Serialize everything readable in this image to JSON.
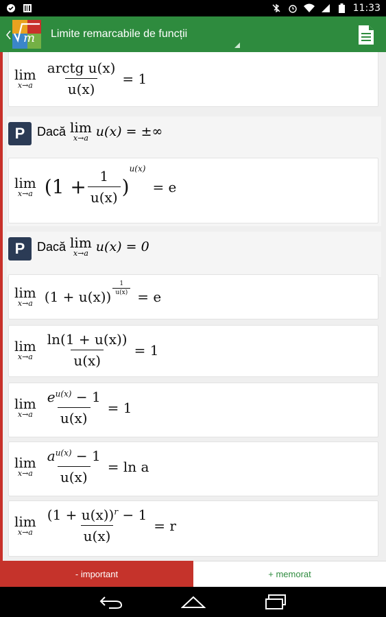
{
  "status_bar": {
    "time": "11:33"
  },
  "action_bar": {
    "title": "Limite remarcabile de funcții"
  },
  "formulas": {
    "f_arctg": {
      "lim": "lim",
      "sub": "x→a",
      "num": "arctg u(x)",
      "den": "u(x)",
      "rhs": "= 1"
    },
    "group1": {
      "badge": "P",
      "cond_prefix": "Dacă",
      "lim": "lim",
      "sub": "x→a",
      "cond_expr": "u(x) = ±∞"
    },
    "f_e_inf": {
      "lim": "lim",
      "sub": "x→a",
      "base_open": "(1 +",
      "num": "1",
      "den": "u(x)",
      "base_close": ")",
      "exp": "u(x)",
      "rhs": "= e"
    },
    "group2": {
      "badge": "P",
      "cond_prefix": "Dacă",
      "lim": "lim",
      "sub": "x→a",
      "cond_expr": "u(x) = 0"
    },
    "f_e_zero": {
      "lim": "lim",
      "sub": "x→a",
      "base": "(1 + u(x))",
      "exp_num": "1",
      "exp_den": "u(x)",
      "rhs": "= e"
    },
    "f_ln": {
      "lim": "lim",
      "sub": "x→a",
      "num": "ln(1 + u(x))",
      "den": "u(x)",
      "rhs": "= 1"
    },
    "f_exp": {
      "lim": "lim",
      "sub": "x→a",
      "num_base": "e",
      "num_exp": "u(x)",
      "num_tail": " − 1",
      "den": "u(x)",
      "rhs": "= 1"
    },
    "f_a": {
      "lim": "lim",
      "sub": "x→a",
      "num_base": "a",
      "num_exp": "u(x)",
      "num_tail": " − 1",
      "den": "u(x)",
      "rhs": "= ln a"
    },
    "f_r": {
      "lim": "lim",
      "sub": "x→a",
      "num_base": "(1 + u(x))",
      "num_exp": "r",
      "num_tail": " − 1",
      "den": "u(x)",
      "rhs": "= r"
    }
  },
  "bottom_bar": {
    "important_label": "- important",
    "memorat_label": "+ memorat"
  },
  "colors": {
    "action_bar": "#2e8b3e",
    "important": "#c5332b",
    "badge": "#2b3b55"
  }
}
